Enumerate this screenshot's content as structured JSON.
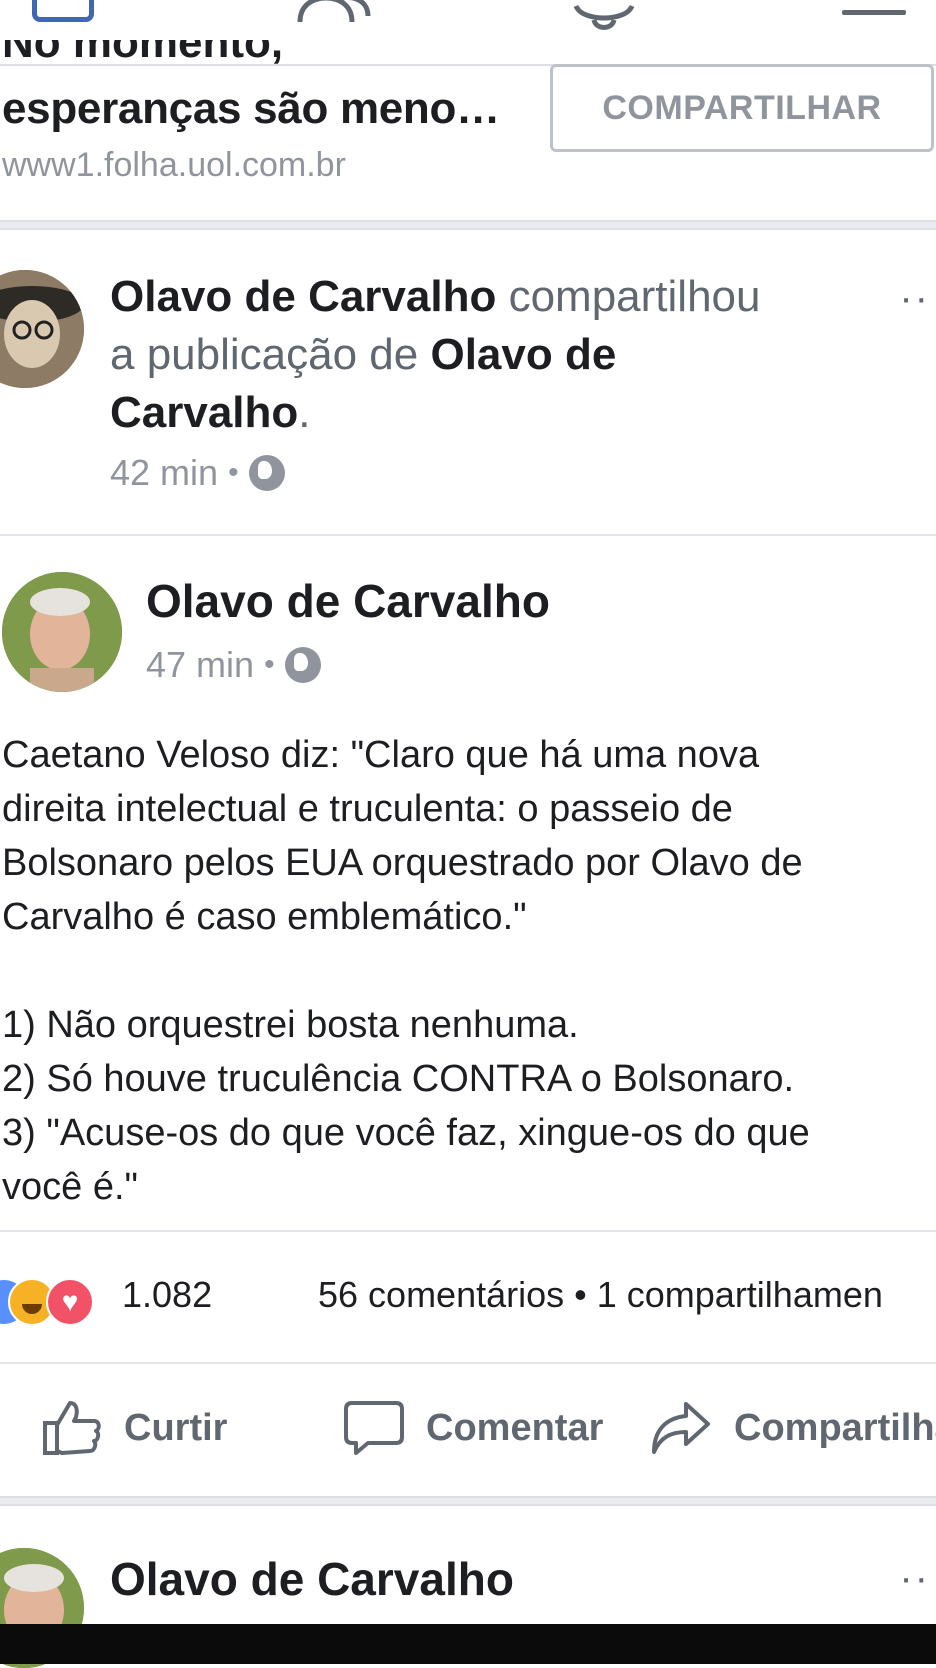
{
  "link_preview": {
    "title_cut": "No momento,",
    "title": "esperanças são meno…",
    "domain": "www1.folha.uol.com.br",
    "share_label": "COMPARTILHAR"
  },
  "shared_post": {
    "actor": "Olavo de Carvalho",
    "verb": " compartilhou",
    "line2_prefix": "a publicação de ",
    "line2_name": "Olavo de",
    "line3_name": "Carvalho",
    "line3_suffix": ".",
    "time": "42 min",
    "dot": "•",
    "more": "··"
  },
  "post": {
    "author": "Olavo de Carvalho",
    "time": "47 min",
    "dot": "•",
    "body": [
      "Caetano Veloso diz: \"Claro que há uma nova",
      "direita intelectual e truculenta: o passeio de",
      "Bolsonaro pelos EUA orquestrado por Olavo de",
      "Carvalho é caso emblemático.\"",
      "",
      "1) Não orquestrei bosta nenhuma.",
      "2) Só houve truculência CONTRA o Bolsonaro.",
      "3) \"Acuse-os do que você faz, xingue-os do que",
      "você é.\""
    ],
    "reaction_count": "1.082",
    "comments_shares": "56 comentários • 1 compartilhamen",
    "actions": {
      "like": "Curtir",
      "comment": "Comentar",
      "share": "Compartilha"
    }
  },
  "next_post": {
    "author": "Olavo de Carvalho",
    "more": "··"
  },
  "icons": [
    "home-icon",
    "friends-icon",
    "notifications-icon",
    "menu-icon",
    "globe-icon",
    "like-icon",
    "comment-icon",
    "share-icon"
  ],
  "colors": {
    "brand": "#4267b2",
    "text": "#1c1e21",
    "muted": "#90949c",
    "love": "#f25268",
    "haha": "#f7b125",
    "like": "#5890ff"
  }
}
